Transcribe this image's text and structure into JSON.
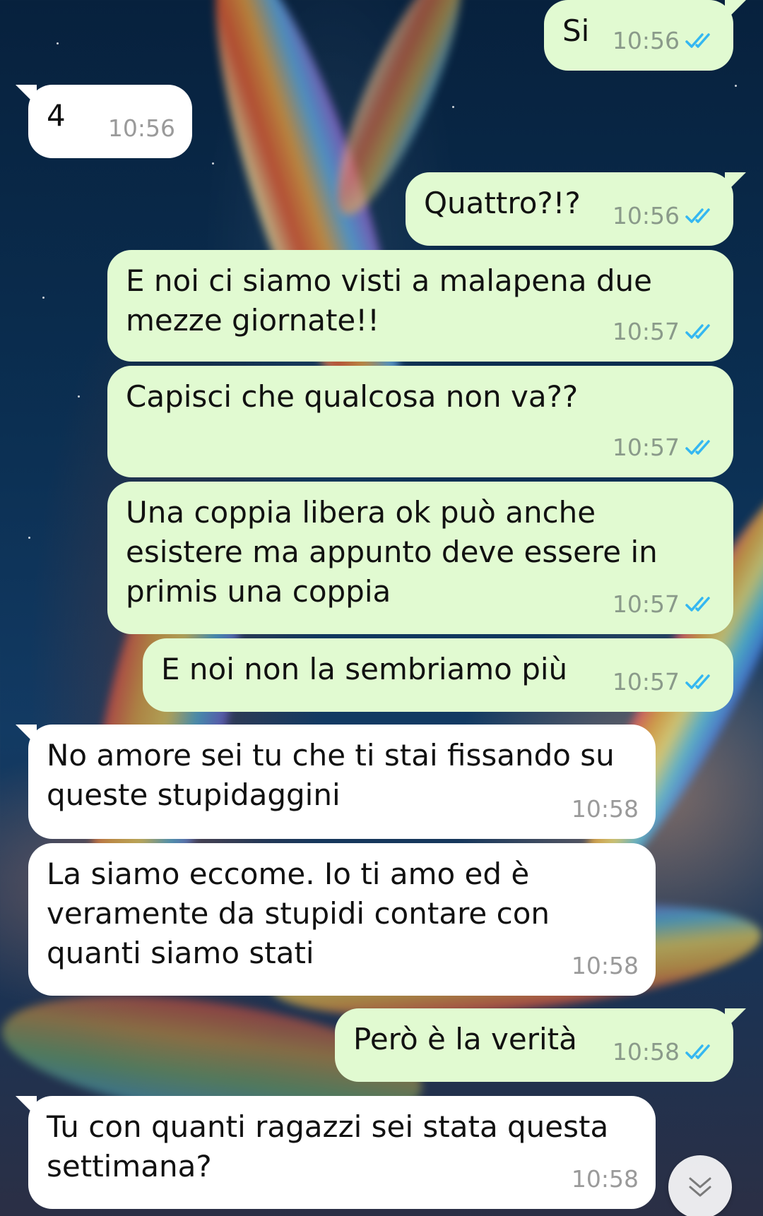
{
  "conversation": {
    "messages": [
      {
        "direction": "out",
        "text": "Si",
        "time": "10:56",
        "status": "read"
      },
      {
        "direction": "in",
        "text": "4",
        "time": "10:56"
      },
      {
        "direction": "out",
        "text": "Quattro?!?",
        "time": "10:56",
        "status": "read"
      },
      {
        "direction": "out",
        "text": "E noi ci siamo visti a malapena due\nmezze giornate!!",
        "time": "10:57",
        "status": "read"
      },
      {
        "direction": "out",
        "text": "Capisci che qualcosa non va??",
        "time": "10:57",
        "status": "read"
      },
      {
        "direction": "out",
        "text": "Una coppia libera ok può anche\nesistere ma appunto deve essere in\nprimis una coppia",
        "time": "10:57",
        "status": "read"
      },
      {
        "direction": "out",
        "text": "E noi non la sembriamo più",
        "time": "10:57",
        "status": "read"
      },
      {
        "direction": "in",
        "text": "No amore sei tu che ti stai fissando su\nqueste stupidaggini",
        "time": "10:58"
      },
      {
        "direction": "in",
        "text": "La siamo eccome. Io ti amo ed è\nveramente da stupidi contare con\nquanti siamo stati",
        "time": "10:58"
      },
      {
        "direction": "out",
        "text": "Però è la verità",
        "time": "10:58",
        "status": "read"
      },
      {
        "direction": "in",
        "text": "Tu con quanti ragazzi sei stata questa\nsettimana?",
        "time": "10:58"
      }
    ]
  },
  "controls": {
    "scroll_down_icon": "double-chevron-down-icon"
  },
  "colors": {
    "outgoing_bubble": "#e1fad1",
    "incoming_bubble": "#ffffff",
    "read_ticks": "#34b7f1"
  }
}
